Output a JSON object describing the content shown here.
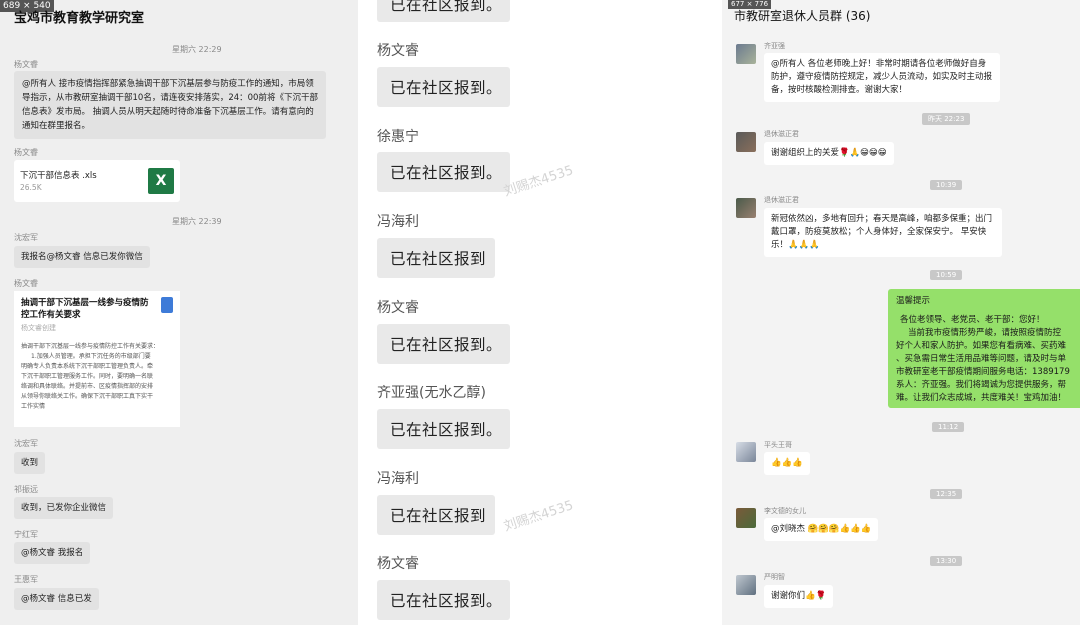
{
  "panel1": {
    "dim_label": "689 × 540",
    "title": "宝鸡市教育教学研究室",
    "ts1": "星期六 22:29",
    "ts2": "星期六 22:39",
    "m1_sender": "杨文睿",
    "m1_text": "@所有人 接市疫情指挥部紧急抽调干部下沉基层参与防疫工作的通知，市局领导指示，从市教研室抽调干部10名，请连夜安排落实，24：00前将《下沉干部信息表》发市局。 抽调人员从明天起随时待命准备下沉基层工作。请有意向的通知在群里报名。",
    "m2_sender": "杨文睿",
    "file_name": "下沉干部信息表 .xls",
    "file_size": "26.5K",
    "file_icon": "X",
    "m3_sender": "沈宏军",
    "m3_text": "我报名@杨文睿 信息已发你微信",
    "m4_sender": "杨文睿",
    "doc_title": "抽调干部下沉基层一线参与疫情防控工作有关要求",
    "doc_author": "杨文睿创建",
    "doc_line0": "抽调干部下沉基层一线参与疫情防控工作有关要求：",
    "doc_line1": "1.加强人员管理。承担下沉任务的市级部门要",
    "doc_line2": "明确专人负责本系统下沉干部职工管理负责人。牵",
    "doc_line3": "下沉干部职工管理服务工作。同时，要明确一名联",
    "doc_line4": "络调和具体联络。并提前市、区疫情指挥部的安排",
    "doc_line5": "从领导你联络关工作。确保下沉干部职工真下实干",
    "doc_line6": "工作实情",
    "m5_sender": "沈宏军",
    "m5_text": "收到",
    "m6_sender": "祁振远",
    "m6_text": "收到，已发你企业微信",
    "m7_sender": "宁红军",
    "m7_text": "@杨文睿 我报名",
    "m8_sender": "王惠军",
    "m8_text": "@杨文睿 信息已发"
  },
  "panel2": {
    "items": [
      {
        "name": "",
        "text": "已在社区报到。"
      },
      {
        "name": "杨文睿",
        "text": "已在社区报到。"
      },
      {
        "name": "徐惠宁",
        "text": "已在社区报到。"
      },
      {
        "name": "冯海利",
        "text": "已在社区报到"
      },
      {
        "name": "杨文睿",
        "text": "已在社区报到。"
      },
      {
        "name": "齐亚强(无水乙醇)",
        "text": "已在社区报到。"
      },
      {
        "name": "冯海利",
        "text": "已在社区报到"
      },
      {
        "name": "杨文睿",
        "text": "已在社区报到。"
      }
    ],
    "watermark": "刘赐杰4535"
  },
  "panel3": {
    "dim_label": "677 × 776",
    "title": "市教研室退休人员群 (36)",
    "m1_sender": "齐亚强",
    "m1_text": "@所有人 各位老师晚上好！非常时期请各位老师做好自身防护，遵守疫情防控规定，减少人员流动，如实及时主动报备，按时核酸检测排查。谢谢大家！",
    "ts1": "昨天 22:23",
    "m2_sender": "退休滋正君",
    "m2_text": "谢谢组织上的关爱🌹🙏😁😁😁",
    "ts2": "10:39",
    "m3_sender": "退休滋正君",
    "m3_text": "新冠依然凶，多地有回升；春天是高峰，咱都多保重；出门戴口罩，防疫莫放松；个人身体好，全家保安宁。 早安快乐！🙏🙏🙏",
    "ts3": "10:59",
    "notice_title": "温馨提示",
    "notice_l1": "各位老领导、老党员、老干部：您好！",
    "notice_l2": "当前我市疫情形势严峻，请按照疫情防控",
    "notice_l3": "好个人和家人防护。如果您有看病难、买药难",
    "notice_l4": "、买急需日常生活用品难等问题，请及时与单",
    "notice_l5": "市教研室老干部疫情期间服务电话：1389179",
    "notice_l6": "系人：齐亚强。我们将竭诚为您提供服务，帮",
    "notice_l7": "难。让我们众志成城，共度难关！宝鸡加油！",
    "ts4": "11:12",
    "m4_sender": "平头王哥",
    "m4_text": "👍👍👍",
    "ts5": "12:35",
    "m5_sender": "李文德的女儿",
    "m5_text": "@刘晓杰 🤗🤗🤗👍👍👍",
    "ts6": "13:30",
    "m6_sender": "严明智",
    "m6_text": "谢谢你们👍🌹"
  }
}
